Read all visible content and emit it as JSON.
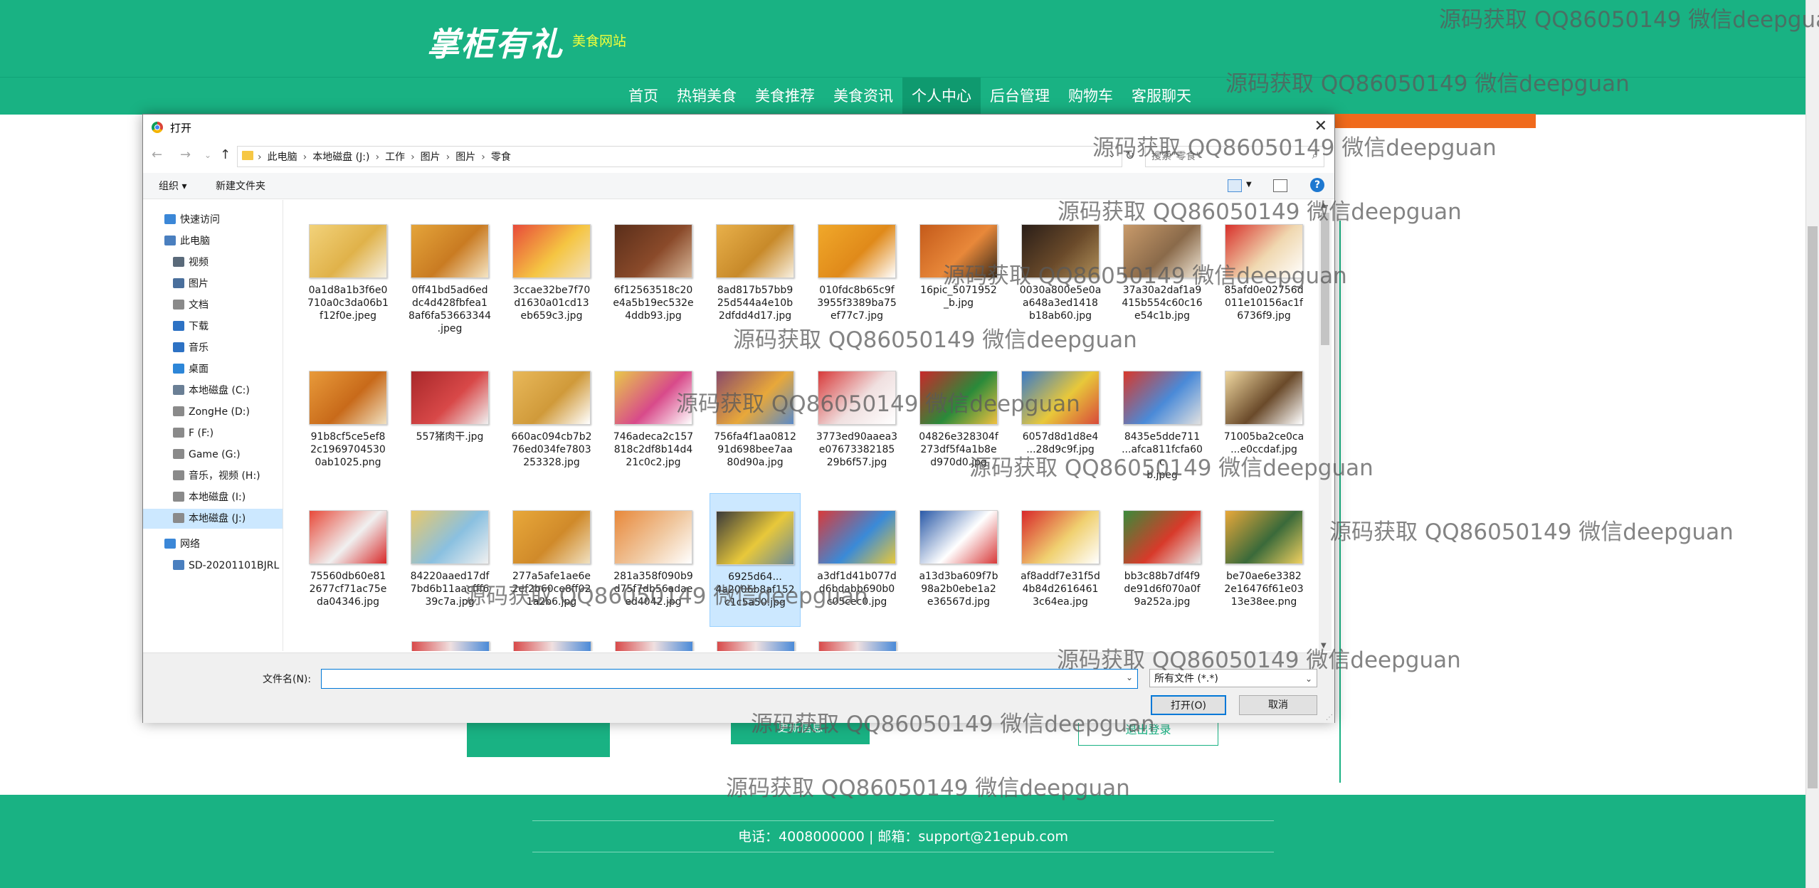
{
  "site": {
    "logo_text": "掌柜有礼",
    "logo_sub": "美食网站",
    "nav": [
      "首页",
      "热销美食",
      "美食推荐",
      "美食资讯",
      "个人中心",
      "后台管理",
      "购物车",
      "客服聊天"
    ],
    "active_nav": "个人中心",
    "update_button": "更新信息",
    "logout_button": "退出登录",
    "footer": "电话：4008000000 | 邮箱：support@21epub.com"
  },
  "dialog": {
    "title": "打开",
    "breadcrumb": [
      "此电脑",
      "本地磁盘 (J:)",
      "工作",
      "图片",
      "图片",
      "零食"
    ],
    "search_placeholder": "搜索\"零食\"",
    "toolbar": {
      "organize": "组织 ▾",
      "new_folder": "新建文件夹"
    },
    "nav_pane": [
      {
        "label": "快速访问",
        "icon": "star-icon",
        "color": "#3b87d7",
        "indent": 0
      },
      {
        "label": "此电脑",
        "icon": "computer-icon",
        "color": "#4a7fbf",
        "indent": 0
      },
      {
        "label": "视频",
        "icon": "video-folder-icon",
        "color": "#5a6a7a",
        "indent": 1
      },
      {
        "label": "图片",
        "icon": "pictures-folder-icon",
        "color": "#4a6f9c",
        "indent": 1
      },
      {
        "label": "文档",
        "icon": "documents-folder-icon",
        "color": "#8a8a8a",
        "indent": 1
      },
      {
        "label": "下载",
        "icon": "download-icon",
        "color": "#2d72c4",
        "indent": 1
      },
      {
        "label": "音乐",
        "icon": "music-icon",
        "color": "#2d72c4",
        "indent": 1
      },
      {
        "label": "桌面",
        "icon": "desktop-icon",
        "color": "#2d86d8",
        "indent": 1
      },
      {
        "label": "本地磁盘 (C:)",
        "icon": "drive-icon",
        "color": "#6a7f95",
        "indent": 1
      },
      {
        "label": "ZongHe (D:)",
        "icon": "drive-icon",
        "color": "#8a8a8a",
        "indent": 1
      },
      {
        "label": "F (F:)",
        "icon": "drive-icon",
        "color": "#8a8a8a",
        "indent": 1
      },
      {
        "label": "Game (G:)",
        "icon": "drive-icon",
        "color": "#8a8a8a",
        "indent": 1
      },
      {
        "label": "音乐，视频 (H:)",
        "icon": "drive-icon",
        "color": "#8a8a8a",
        "indent": 1
      },
      {
        "label": "本地磁盘 (I:)",
        "icon": "drive-icon",
        "color": "#8a8a8a",
        "indent": 1
      },
      {
        "label": "本地磁盘 (J:)",
        "icon": "drive-icon",
        "color": "#8a8a8a",
        "indent": 1,
        "selected": true
      },
      {
        "label": "网络",
        "icon": "network-icon",
        "color": "#3b87d7",
        "indent": 0
      },
      {
        "label": "SD-20201101BJRL",
        "icon": "network-computer-icon",
        "color": "#4a7fbf",
        "indent": 1
      }
    ],
    "files": [
      {
        "name": "0a1d8a1b3f6e0710a0c3da06b1f12f0e.jpeg",
        "lines": [
          "0a1d8a1b3f6e0",
          "710a0c3da06b1",
          "f12f0e.jpeg"
        ],
        "colors": [
          "#f2d27a",
          "#e0b24a",
          "#f6f1e4"
        ]
      },
      {
        "name": "0ff41bd5ad6eddc4d428fbfea18af6fa53663344.jpeg",
        "lines": [
          "0ff41bd5ad6ed",
          "dc4d428fbfea1",
          "8af6fa53663344",
          ".jpeg"
        ],
        "colors": [
          "#e4a43a",
          "#c97b22",
          "#f5e5c4"
        ]
      },
      {
        "name": "3ccae32be7f70d1630a01cd13eb659c3.jpg",
        "lines": [
          "3ccae32be7f70",
          "d1630a01cd13",
          "eb659c3.jpg"
        ],
        "colors": [
          "#e84a3a",
          "#f5c542",
          "#f2e2c2"
        ]
      },
      {
        "name": "6f12563518c20e4a5b19ec532e4ddb93.jpg",
        "lines": [
          "6f12563518c20",
          "e4a5b19ec532e",
          "4ddb93.jpg"
        ],
        "colors": [
          "#5a2e1a",
          "#8a4a2a",
          "#d8b89a"
        ]
      },
      {
        "name": "8ad817b57bb925d544a4e10b2dfdd4d17.jpg",
        "lines": [
          "8ad817b57bb9",
          "25d544a4e10b",
          "2dfdd4d17.jpg"
        ],
        "colors": [
          "#e8b04a",
          "#c88a2a",
          "#f8f0e0"
        ]
      },
      {
        "name": "010fdc8b65c9f3955f3389ba75ef77c7.jpg",
        "lines": [
          "010fdc8b65c9f",
          "3955f3389ba75",
          "ef77c7.jpg"
        ],
        "colors": [
          "#f0a82a",
          "#e08a1a",
          "#ffffff"
        ]
      },
      {
        "name": "16pic_5071952_b.jpg",
        "lines": [
          "16pic_5071952",
          "_b.jpg"
        ],
        "colors": [
          "#c45a1a",
          "#e8883a",
          "#3a2a1a"
        ]
      },
      {
        "name": "0030a800e5e0aa648a3ed1418b18ab60.jpg",
        "lines": [
          "0030a800e5e0a",
          "a648a3ed1418",
          "b18ab60.jpg"
        ],
        "colors": [
          "#2a1e18",
          "#6a4a2a",
          "#b0905a"
        ]
      },
      {
        "name": "37a30a2daf1a9415b554c60c16e54c1b.jpg",
        "lines": [
          "37a30a2daf1a9",
          "415b554c60c16",
          "e54c1b.jpg"
        ],
        "colors": [
          "#c89a6a",
          "#8a6a4a",
          "#f0e6d6"
        ]
      },
      {
        "name": "85afd0e02756d011e10156ac1f6736f9.jpg",
        "lines": [
          "85afd0e02756d",
          "011e10156ac1f",
          "6736f9.jpg"
        ],
        "colors": [
          "#d8302a",
          "#f0d8b0",
          "#ffffff"
        ]
      },
      {
        "name": "91b8cf5ce5ef82c19697045300ab1025.png",
        "lines": [
          "91b8cf5ce5ef8",
          "2c1969704530",
          "0ab1025.png"
        ],
        "colors": [
          "#e89a3a",
          "#c86a1a",
          "#f0e0c0"
        ]
      },
      {
        "name": "557猪肉干.jpg",
        "lines": [
          "557猪肉干.jpg"
        ],
        "colors": [
          "#a8282a",
          "#d84848",
          "#f0f0f0"
        ]
      },
      {
        "name": "660ac094cb7b276ed034fe7803253328.jpg",
        "lines": [
          "660ac094cb7b2",
          "76ed034fe7803",
          "253328.jpg"
        ],
        "colors": [
          "#e8b85a",
          "#d09a3a",
          "#ffffff"
        ]
      },
      {
        "name": "746adeca2c157818c2df8b14d421c0c2.jpg",
        "lines": [
          "746adeca2c157",
          "818c2df8b14d4",
          "21c0c2.jpg"
        ],
        "colors": [
          "#e8c84a",
          "#d84a8a",
          "#ffffff"
        ]
      },
      {
        "name": "756fa4f1aa081291d698bee7aa80d90a.jpg",
        "lines": [
          "756fa4f1aa0812",
          "91d698bee7aa",
          "80d90a.jpg"
        ],
        "colors": [
          "#8a4a6a",
          "#e8a83a",
          "#5a8ac8"
        ]
      },
      {
        "name": "3773ed90aaea3e0767338218529b6f57.jpg",
        "lines": [
          "3773ed90aaea3",
          "e07673382185",
          "29b6f57.jpg"
        ],
        "colors": [
          "#d83a3a",
          "#f0e0e0",
          "#ffffff"
        ]
      },
      {
        "name": "04826e328304f273df5f4a1b8ed970d0.jpg",
        "lines": [
          "04826e328304f",
          "273df5f4a1b8e",
          "d970d0.jpg"
        ],
        "colors": [
          "#c8282a",
          "#2a8a3a",
          "#f0c040"
        ]
      },
      {
        "name": "6057d8d1d8e4d1f62f75d8f6e2d6e28d9c9f.jpg",
        "lines": [
          "6057d8d1d8e4",
          "...28d9c9f.jpg"
        ],
        "colors": [
          "#3a7ac8",
          "#e8c83a",
          "#d84a3a"
        ]
      },
      {
        "name": "8435e5dde711d9edf61d42d8e0afca811fcfa60cb.jpeg",
        "lines": [
          "8435e5dde711",
          "...afca811fcfa60c",
          "b.jpeg"
        ],
        "colors": [
          "#d8382a",
          "#4a8ad8",
          "#e0e0e0"
        ]
      },
      {
        "name": "71005ba2ce0ca74...e0ccdaf.jpg",
        "lines": [
          "71005ba2ce0ca",
          "...e0ccdaf.jpg"
        ],
        "colors": [
          "#f0d8a0",
          "#6a4a2a",
          "#ffffff"
        ]
      },
      {
        "name": "75560db60e812677cf71ac75eda04346.jpg",
        "lines": [
          "75560db60e81",
          "2677cf71ac75e",
          "da04346.jpg"
        ],
        "colors": [
          "#e84a3a",
          "#f0f0f0",
          "#d82a2a"
        ]
      },
      {
        "name": "84220aaed17df7bd6b11aacfff639c7a.jpg",
        "lines": [
          "84220aaed17df",
          "7bd6b11aacfff6",
          "39c7a.jpg"
        ],
        "colors": [
          "#e8c86a",
          "#8ac0e0",
          "#f0f0f0"
        ]
      },
      {
        "name": "277a5afe1ae6e2ef2b60ce8ff021a2b6.jpg",
        "lines": [
          "277a5afe1ae6e",
          "2ef2b60ce8ff02",
          "1a2b6.jpg"
        ],
        "colors": [
          "#e8a83a",
          "#d08a2a",
          "#f0e0c0"
        ]
      },
      {
        "name": "281a358f090b9d75f7db56adaeed4042.jpg",
        "lines": [
          "281a358f090b9",
          "d75f7db56adae",
          "ed4042.jpg"
        ],
        "colors": [
          "#e8883a",
          "#f0c8a0",
          "#ffffff"
        ]
      },
      {
        "name": "6925d64...4a2006b8af152c1c5a50.jpg",
        "lines": [
          "6925d64...",
          "4a2006b8af152",
          "c1c5a50.jpg"
        ],
        "colors": [
          "#3a3a3a",
          "#e8c83a",
          "#6a8a9a"
        ],
        "selected": true
      },
      {
        "name": "a3df1d41b077dd6bdabb690b0c05cec0.jpg",
        "lines": [
          "a3df1d41b077d",
          "d6bdabb690b0",
          "c05cec0.jpg"
        ],
        "colors": [
          "#d83a3a",
          "#3a8ad8",
          "#e8c83a"
        ]
      },
      {
        "name": "a13d3ba609f7b98a2b0ebe1a2e36567d.jpg",
        "lines": [
          "a13d3ba609f7b",
          "98a2b0ebe1a2",
          "e36567d.jpg"
        ],
        "colors": [
          "#2a5aa8",
          "#ffffff",
          "#d83a3a"
        ]
      },
      {
        "name": "af8addf7e31f5d4b84d26164613c64ea.jpg",
        "lines": [
          "af8addf7e31f5d",
          "4b84d2616461",
          "3c64ea.jpg"
        ],
        "colors": [
          "#d8282a",
          "#f0d070",
          "#ffffff"
        ]
      },
      {
        "name": "bb3c88b7df4f9de91d6f070a0f9a252a.jpg",
        "lines": [
          "bb3c88b7df4f9",
          "de91d6f070a0f",
          "9a252a.jpg"
        ],
        "colors": [
          "#3a8a3a",
          "#d83a2a",
          "#e8e8e8"
        ]
      },
      {
        "name": "be70ae6e33822e16476f61e0313e38ee.png",
        "lines": [
          "be70ae6e3382",
          "2e16476f61e03",
          "13e38ee.png"
        ],
        "colors": [
          "#e8a83a",
          "#3a6a3a",
          "#f0d060"
        ]
      }
    ],
    "filename_label": "文件名(N):",
    "filename_value": "",
    "file_type": "所有文件 (*.*)",
    "open_button": "打开(O)",
    "cancel_button": "取消"
  },
  "watermarks": [
    "源码获取 QQ86050149 微信deepguan",
    "源码获取 QQ86050149 微信deepguan",
    "源码获取 QQ86050149 微信deepguan",
    "源码获取 QQ86050149 微信deepguan",
    "源码获取 QQ86050149 微信deepguan",
    "源码获取 QQ86050149 微信deepguan",
    "源码获取 QQ86050149 微信deepguan",
    "源码获取 QQ86050149 微信deepguan",
    "源码获取 QQ86050149 微信deepguan",
    "源码获取 QQ86050149 微信deepguan",
    "源码获取 QQ86050149 微信deepguan",
    "源码获取 QQ86050149 微信deepguan",
    "源码获取 QQ86050149 微信deepguan"
  ]
}
